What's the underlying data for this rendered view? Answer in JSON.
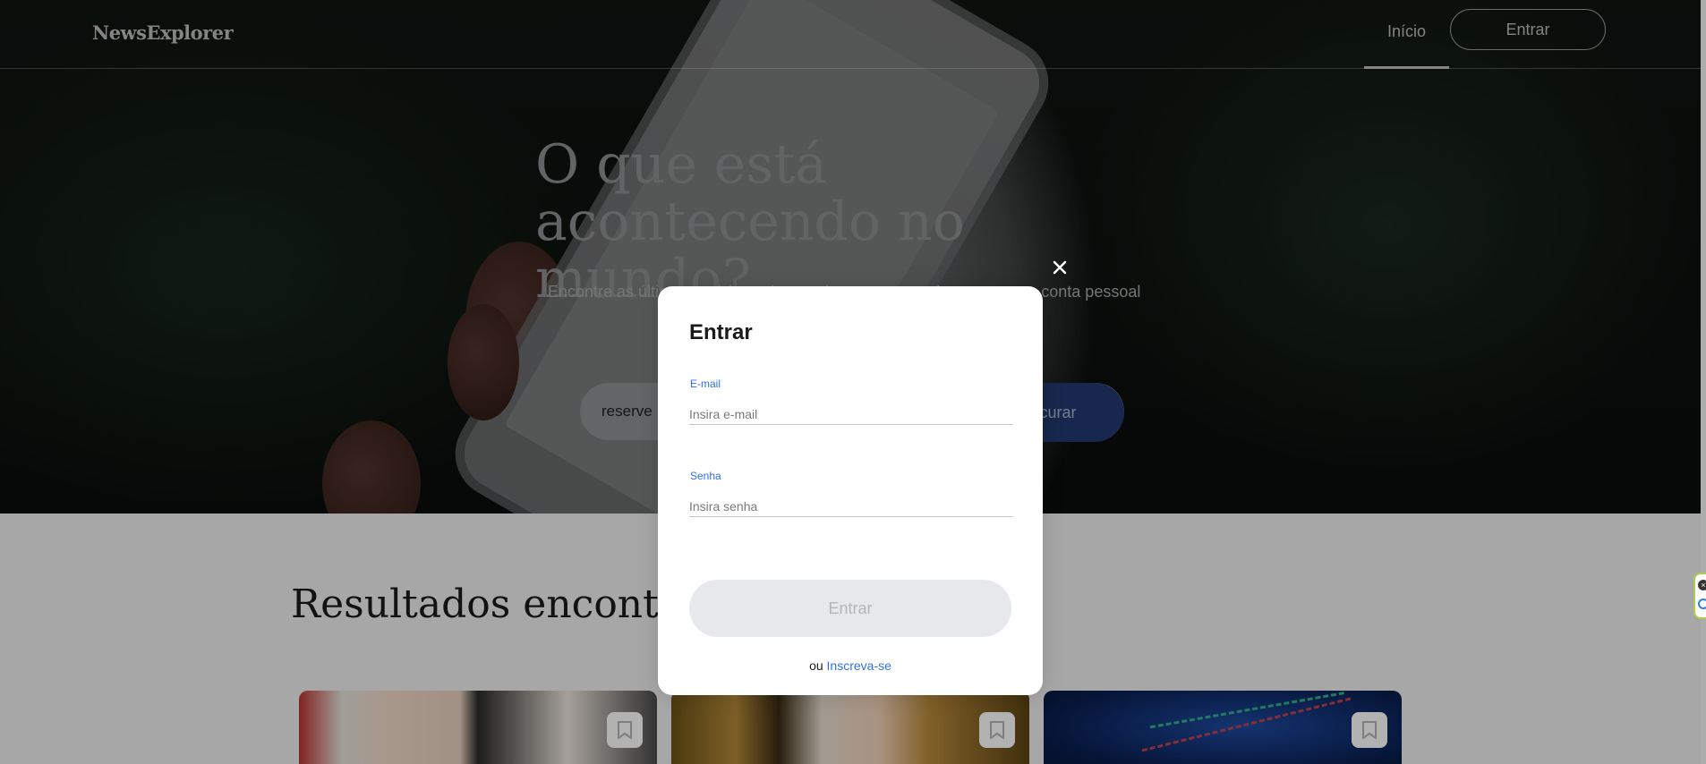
{
  "header": {
    "logo": "NewsExplorer",
    "nav_home": "Início",
    "nav_login": "Entrar"
  },
  "hero": {
    "title": "O que está acontecendo no mundo?",
    "subtitle": "Encontre as últimas notícias sobre qualquer tema e salve-as em sua conta pessoal",
    "search_value": "reserve",
    "search_button": "Procurar"
  },
  "results": {
    "title": "Resultados encontrados",
    "cards": [
      {
        "bookmark_icon": "bookmark-icon"
      },
      {
        "bookmark_icon": "bookmark-icon"
      },
      {
        "bookmark_icon": "bookmark-icon"
      }
    ]
  },
  "modal": {
    "title": "Entrar",
    "email_label": "E-mail",
    "email_placeholder": "Insira e-mail",
    "email_value": "",
    "password_label": "Senha",
    "password_placeholder": "Insira senha",
    "password_value": "",
    "submit": "Entrar",
    "footer_prefix": "ou",
    "footer_link": "Inscreva-se",
    "close_icon": "close-icon"
  },
  "colors": {
    "accent": "#2f71e5",
    "search_button": "#2f71e5",
    "disabled_button": "#e6e8eb"
  }
}
